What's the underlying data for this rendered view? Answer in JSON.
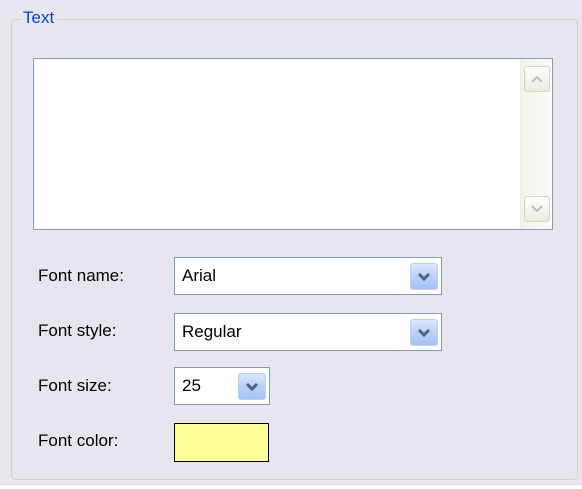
{
  "group": {
    "title": "Text"
  },
  "textarea": {
    "value": ""
  },
  "font_name": {
    "label": "Font name:",
    "value": "Arial"
  },
  "font_style": {
    "label": "Font style:",
    "value": "Regular"
  },
  "font_size": {
    "label": "Font size:",
    "value": "25"
  },
  "font_color": {
    "label": "Font color:",
    "color": "#ffff99"
  },
  "icons": {
    "scroll_up": "scroll-up-arrow",
    "scroll_down": "scroll-down-arrow",
    "dropdown": "chevron-down"
  },
  "colors": {
    "panel_bg": "#e7e6ee",
    "group_title": "#0046d5",
    "field_border": "#7f9db9",
    "dropdown_button": "#b8cff8",
    "dropdown_arrow": "#4d6185"
  }
}
